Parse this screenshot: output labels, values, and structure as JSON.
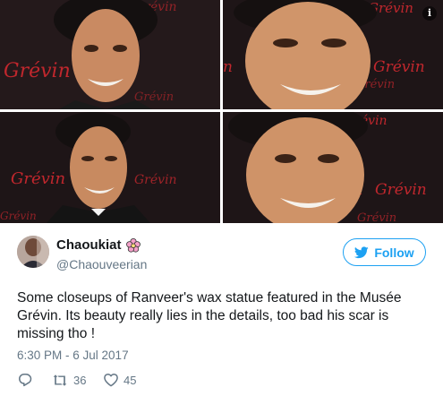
{
  "photos": {
    "panels": [
      {
        "logo": "Grévin"
      },
      {
        "logo": "Grévin"
      },
      {
        "logo": "Grévin"
      },
      {
        "logo": "Grévin"
      }
    ],
    "info_icon": {
      "glyph": "i",
      "name": "info-icon"
    }
  },
  "tweet": {
    "author": {
      "display_name": "Chaoukiat",
      "handle": "@Chaouveerian",
      "badge_icon": "flower-icon"
    },
    "follow_label": "Follow",
    "text": "Some closeups of Ranveer's wax statue featured in the Musée Grévin. Its beauty really lies in the details, too bad his scar is missing tho !",
    "timestamp": "6:30 PM - 6 Jul 2017",
    "actions": {
      "reply_icon": "reply-icon",
      "retweet_icon": "retweet-icon",
      "retweet_count": "36",
      "like_icon": "heart-icon",
      "like_count": "45"
    }
  },
  "colors": {
    "accent": "#1da1f2",
    "muted_text": "#657786",
    "backdrop": "#1c1416",
    "logo_red": "#c0272d"
  }
}
